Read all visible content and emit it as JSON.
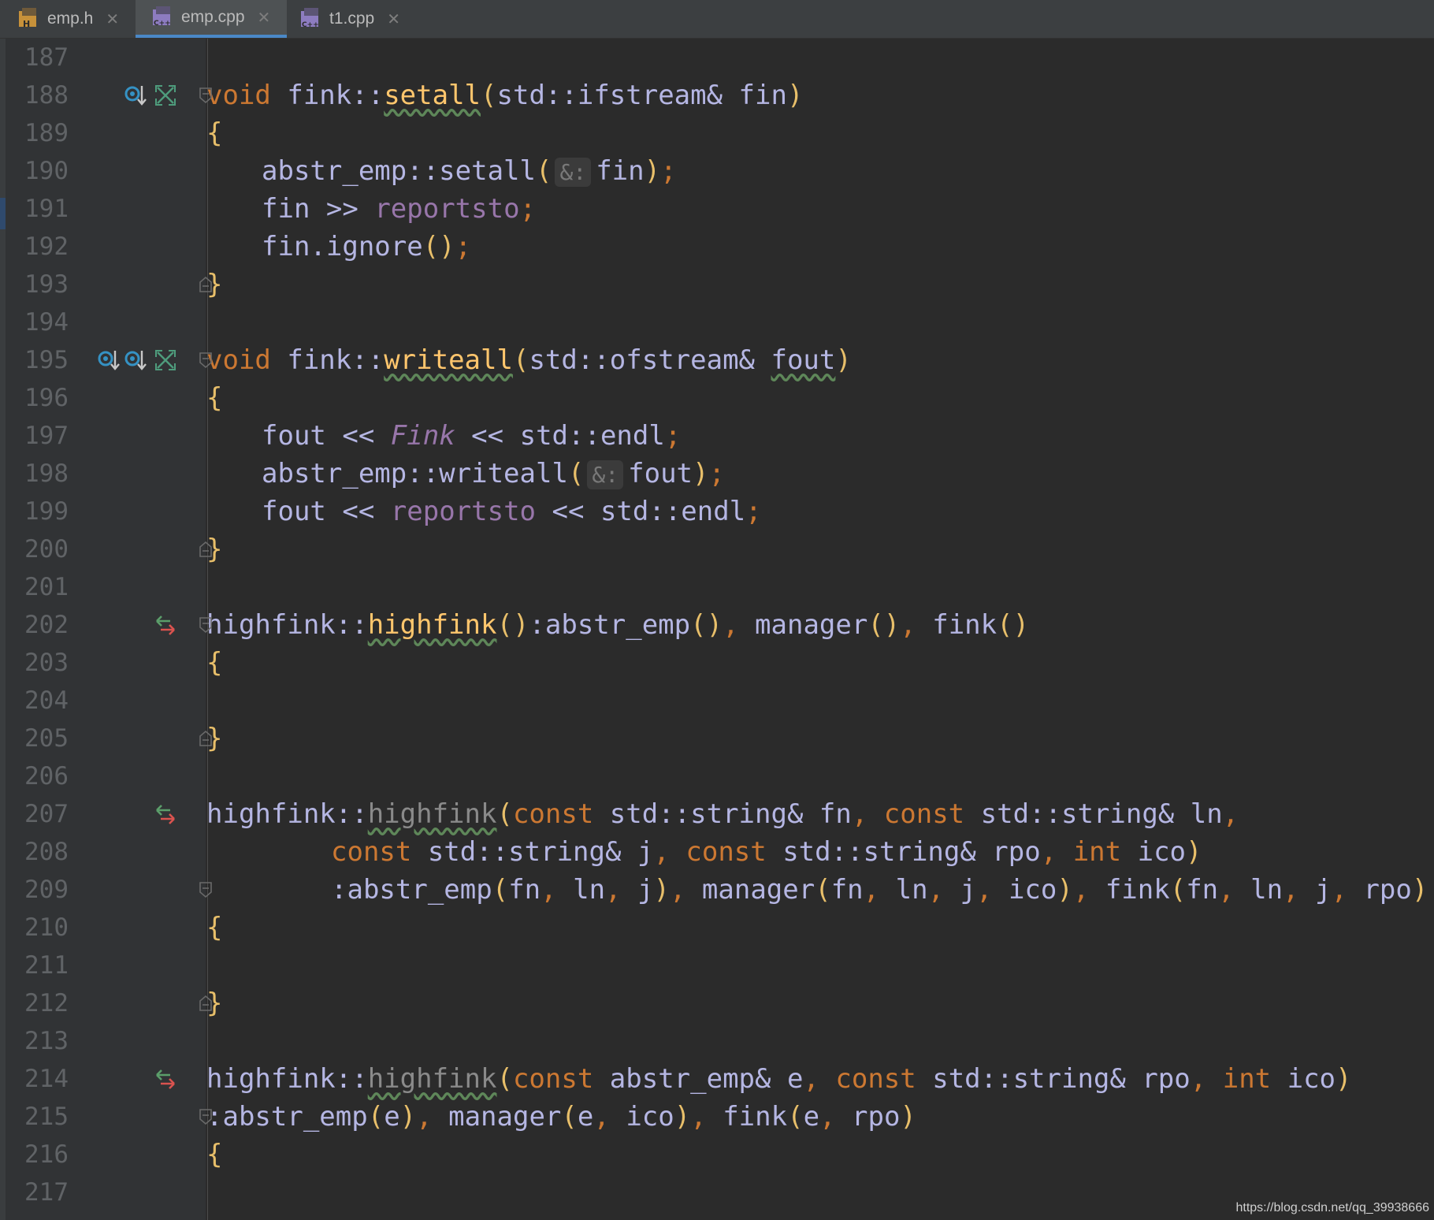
{
  "tabs": [
    {
      "label": "emp.h",
      "icon": "header-file-icon",
      "active": false
    },
    {
      "label": "emp.cpp",
      "icon": "cpp-file-icon",
      "active": true
    },
    {
      "label": "t1.cpp",
      "icon": "cpp-file-icon",
      "active": false
    }
  ],
  "editor": {
    "line_numbers": [
      "187",
      "188",
      "189",
      "190",
      "191",
      "192",
      "193",
      "194",
      "195",
      "196",
      "197",
      "198",
      "199",
      "200",
      "201",
      "202",
      "203",
      "204",
      "205",
      "206",
      "207",
      "208",
      "209",
      "210",
      "211",
      "212",
      "213",
      "214",
      "215",
      "216",
      "217"
    ],
    "code": {
      "l188": [
        "void",
        " fink::",
        "setall",
        "(",
        "std::ifstream& fin",
        ")"
      ],
      "l189": "{",
      "l190": [
        "abstr_emp::setall",
        "(",
        "&:",
        "fin",
        ")",
        ";"
      ],
      "l191": [
        "fin ",
        ">>",
        " ",
        "reportsto",
        ";"
      ],
      "l192": [
        "fin.ignore",
        "()",
        ";"
      ],
      "l193": "}",
      "l195": [
        "void",
        " fink::",
        "writeall",
        "(",
        "std::ofstream& ",
        "fout",
        ")"
      ],
      "l196": "{",
      "l197": [
        "fout ",
        "<<",
        " ",
        "Fink",
        " ",
        "<<",
        " std::endl",
        ";"
      ],
      "l198": [
        "abstr_emp::writeall",
        "(",
        "&:",
        "fout",
        ")",
        ";"
      ],
      "l199": [
        "fout ",
        "<<",
        " ",
        "reportsto",
        " ",
        "<<",
        " std::endl",
        ";"
      ],
      "l200": "}",
      "l202": [
        "highfink::",
        "highfink",
        "()",
        ":abstr_emp",
        "()",
        ",",
        " manager",
        "()",
        ",",
        " fink",
        "()"
      ],
      "l203": "{",
      "l205": "}",
      "l207": [
        "highfink::",
        "highfink",
        "(",
        "const",
        " std::string& fn",
        ",",
        " ",
        "const",
        " std::string& ln",
        ","
      ],
      "l208": [
        "const",
        " std::string& j",
        ",",
        " ",
        "const",
        " std::string& rpo",
        ",",
        " ",
        "int",
        " ico",
        ")"
      ],
      "l209": [
        ":abstr_emp",
        "(",
        "fn",
        ",",
        " ln",
        ",",
        " j",
        ")",
        ",",
        " manager",
        "(",
        "fn",
        ",",
        " ln",
        ",",
        " j",
        ",",
        " ico",
        ")",
        ",",
        " fink",
        "(",
        "fn",
        ",",
        " ln",
        ",",
        " j",
        ",",
        " rpo",
        ")"
      ],
      "l210": "{",
      "l212": "}",
      "l214": [
        "highfink::",
        "highfink",
        "(",
        "const",
        " abstr_emp& e",
        ",",
        " ",
        "const",
        " std::string& rpo",
        ",",
        " ",
        "int",
        " ico",
        ")"
      ],
      "l215": [
        ":abstr_emp",
        "(",
        "e",
        ")",
        ",",
        " manager",
        "(",
        "e",
        ",",
        " ico",
        ")",
        ",",
        " fink",
        "(",
        "e",
        ",",
        " rpo",
        ")"
      ],
      "l216": "{"
    }
  },
  "watermark": "https://blog.csdn.net/qq_39938666",
  "colors": {
    "background": "#2b2b2b",
    "gutter": "#313335",
    "keyword": "#cc7832",
    "function_decl": "#ffc66d",
    "member": "#9876aa",
    "identifier": "#a9b7c6",
    "tab_active_underline": "#4a88c7"
  },
  "gutter_icons": [
    {
      "line": "188",
      "icons": [
        "overrides-icon",
        "collapse-icon"
      ]
    },
    {
      "line": "195",
      "icons": [
        "implements-icon",
        "overrides-icon",
        "collapse-icon"
      ]
    },
    {
      "line": "202",
      "icons": [
        "declaration-navigate-icon"
      ]
    },
    {
      "line": "207",
      "icons": [
        "declaration-navigate-icon"
      ]
    },
    {
      "line": "214",
      "icons": [
        "declaration-navigate-icon"
      ]
    }
  ]
}
